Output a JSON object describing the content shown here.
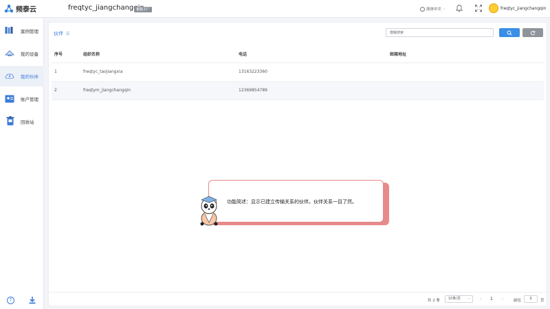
{
  "app": {
    "logo_text": "频泰云",
    "user_title": "freqtyc_jiangchangqin",
    "badge": "客服工厂"
  },
  "topbar": {
    "language": "简体中文",
    "username": "freqtyc_jiangchangqin"
  },
  "sidebar": {
    "items": [
      {
        "label": "案例管理",
        "icon": "case-icon"
      },
      {
        "label": "我的设备",
        "icon": "device-icon"
      },
      {
        "label": "我的伙伴",
        "icon": "partner-icon"
      },
      {
        "label": "账户管理",
        "icon": "account-icon"
      },
      {
        "label": "回收站",
        "icon": "trash-icon"
      }
    ],
    "active_index": 2,
    "help_label": "?"
  },
  "page": {
    "breadcrumb": "伙伴"
  },
  "search": {
    "placeholder": "模糊搜索"
  },
  "table": {
    "headers": [
      "序号",
      "组织名称",
      "电话",
      "邮箱地址"
    ],
    "rows": [
      {
        "no": "1",
        "name": "freqtyc_taojiangxia",
        "phone": "13163223360",
        "email": ""
      },
      {
        "no": "2",
        "name": "freqtym_jiangchangqin",
        "phone": "12369854789",
        "email": ""
      }
    ]
  },
  "pagination": {
    "total": "共 2 条",
    "page_size": "10条/页",
    "current_page": "1",
    "goto_label": "前往",
    "goto_value": "1",
    "page_unit": "页"
  },
  "callout": {
    "text": "功能简述：显示已建立传输关系的伙伴。伙伴关系一目了然。"
  },
  "colors": {
    "accent": "#3a8ee6",
    "callout_border": "#e48a8a",
    "active_bg": "#ecf1f8"
  }
}
